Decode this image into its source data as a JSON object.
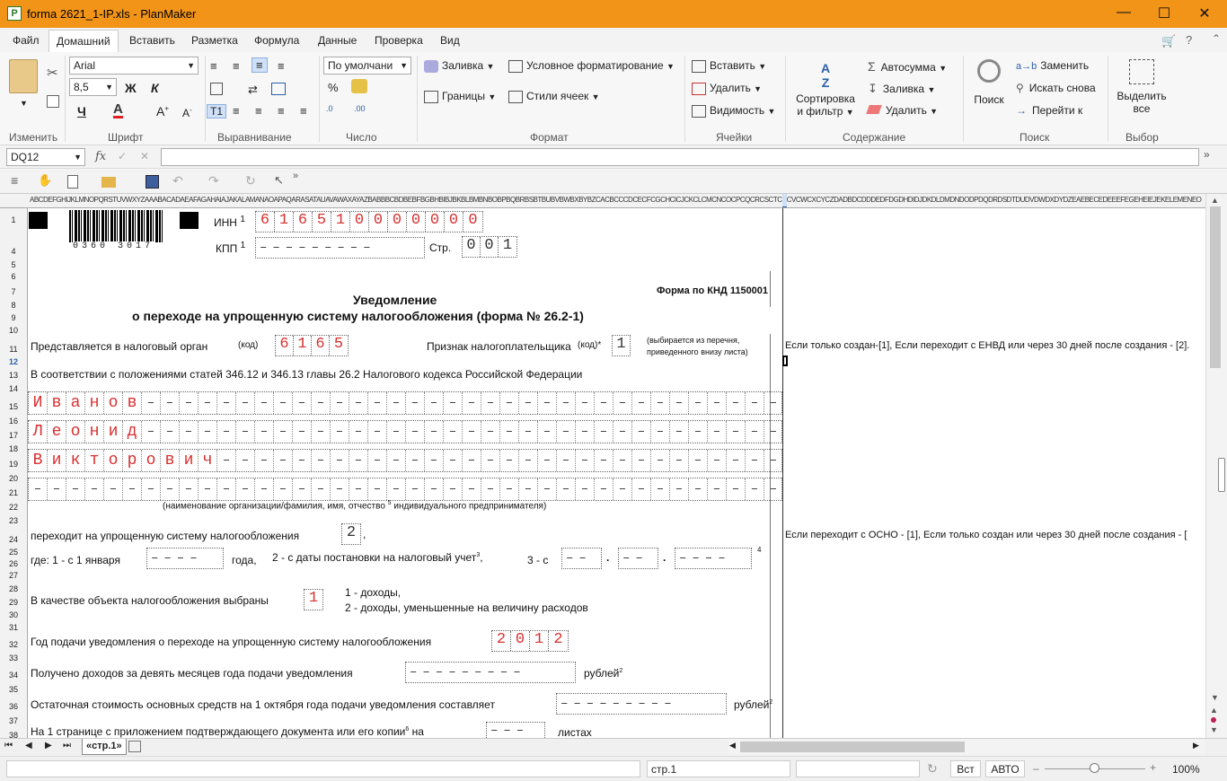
{
  "window": {
    "title": "forma 2621_1-IP.xls - PlanMaker",
    "app_icon": "P"
  },
  "menu": [
    "Файл",
    "Домашний",
    "Вставить",
    "Разметка",
    "Формула",
    "Данные",
    "Проверка",
    "Вид"
  ],
  "ribbon": {
    "font_name": "Arial",
    "font_size": "8,5",
    "number_format": "По умолчани",
    "bold": "Ж",
    "italic": "К",
    "underline": "Ч",
    "groups": [
      "Изменить",
      "Шрифт",
      "Выравнивание",
      "Число",
      "Формат",
      "Ячейки",
      "Содержание",
      "Поиск",
      "Выбор"
    ],
    "format_fill": "Заливка",
    "format_cond": "Условное форматирование",
    "format_borders": "Границы",
    "format_styles": "Стили ячеек",
    "cells_insert": "Вставить",
    "cells_delete": "Удалить",
    "cells_visibility": "Видимость",
    "sort_label1": "Сортировка",
    "sort_label2": "и фильтр",
    "autosum": "Автосумма",
    "fill": "Заливка",
    "delete": "Удалить",
    "search": "Поиск",
    "replace": "Заменить",
    "find_again": "Искать снова",
    "goto": "Перейти к",
    "select_all1": "Выделить",
    "select_all2": "все",
    "percent": "%"
  },
  "formula": {
    "cell_ref": "DQ12",
    "fx": "fx",
    "value": ""
  },
  "rows": [
    "1",
    "4",
    "5",
    "6",
    "7",
    "8",
    "9",
    "10",
    "11",
    "12",
    "13",
    "14",
    "15",
    "16",
    "17",
    "18",
    "19",
    "20",
    "21",
    "22",
    "23",
    "24",
    "25",
    "26",
    "27",
    "28",
    "29",
    "30",
    "31",
    "32",
    "33",
    "34",
    "35",
    "36",
    "37",
    "38"
  ],
  "doc": {
    "barcode_number": "0360 3017",
    "inn_label": "ИНН",
    "inn_value": [
      "6",
      "1",
      "6",
      "5",
      "1",
      "0",
      "0",
      "0",
      "0",
      "0",
      "0",
      "0"
    ],
    "kpp_label": "КПП",
    "page_label": "Стр.",
    "page_value": [
      "0",
      "0",
      "1"
    ],
    "title1": "Уведомление",
    "title2": "о переходе на упрощенную систему налогообложения (форма № 26.2-1)",
    "knd": "Форма по КНД 1150001",
    "submitted_to": "Представляется в налоговый орган",
    "code_label": "(код)",
    "tax_code": [
      "6",
      "1",
      "6",
      "5"
    ],
    "taxpayer_sign": "Признак налогоплательщика",
    "code_label2": "(код)*",
    "taxpayer_sign_value": "1",
    "hint1": "(выбирается из перечня,",
    "hint2": "приведенного внизу листа)",
    "law_text": "В соответствии с положениями статей 346.12 и 346.13 главы 26.2 Налогового кодекса Российской Федерации",
    "surname": [
      "И",
      "в",
      "а",
      "н",
      "о",
      "в"
    ],
    "name": [
      "Л",
      "е",
      "о",
      "н",
      "и",
      "д"
    ],
    "patronymic": [
      "В",
      "и",
      "к",
      "т",
      "о",
      "р",
      "о",
      "в",
      "и",
      "ч"
    ],
    "name_caption": "(наименование организации/фамилия, имя, отчество",
    "name_caption2": "индивидуального предпринимателя)",
    "sup5": "5",
    "transition_label": "переходит на упрощенную  систему налогообложения",
    "transition_value": "2",
    "where_label": "где: 1 - с 1 января",
    "year_label": "года,",
    "option2": "2 - с даты постановки на налоговый учет",
    "sup3": "3",
    "option3": "3 - с",
    "sup4": "4",
    "object_label": "В качестве объекта налогообложения выбраны",
    "object_value": "1",
    "object_opt1": "1 - доходы,",
    "object_opt2": "2 - доходы, уменьшенные на величину расходов",
    "year_submit_label": "Год подачи уведомления о переходе на упрощенную систему налогообложения",
    "year_submit_value": [
      "2",
      "0",
      "1",
      "2"
    ],
    "income_label": "Получено доходов за девять месяцев года подачи уведомления",
    "rubles": "рублей",
    "sup2": "2",
    "residual_label": "Остаточная стоимость основных средств на 1 октября года подачи уведомления составляет",
    "pages_label": "На 1 странице с приложением подтверждающего документа или его копии",
    "sup6": "6",
    "on": "на",
    "sheets": "листах",
    "sup1": "1",
    "note_row11": "Если только создан-[1], Если  переходит с ЕНВД или через 30 дней после создания - [2].",
    "note_row24": "Если переходит с ОСНО - [1], Если только создан  или через 30 дней после создания - [",
    "asterisk": "*"
  },
  "tabs": {
    "sheet": "«стр.1»"
  },
  "status": {
    "page": "стр.1",
    "mode1": "Вст",
    "mode2": "АВТО",
    "zoom": "100%"
  }
}
